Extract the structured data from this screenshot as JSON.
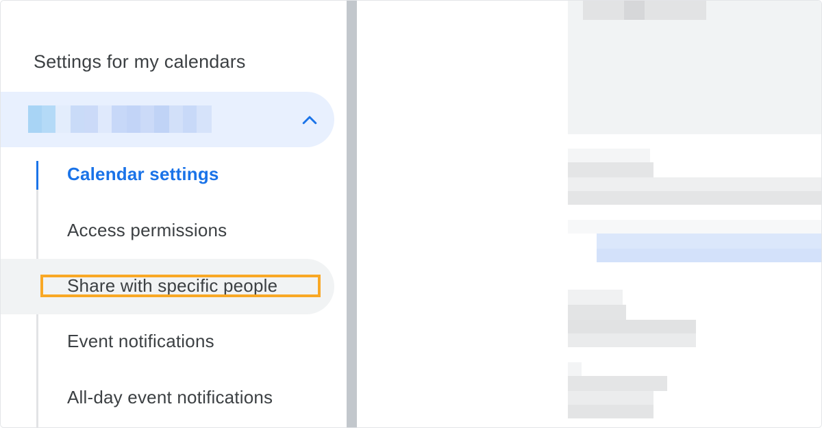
{
  "sidebar": {
    "section_title": "Settings for my calendars",
    "calendar_name_redacted": true,
    "expand_icon": "chevron-up-icon",
    "items": [
      {
        "label": "Calendar settings",
        "active": true
      },
      {
        "label": "Access permissions",
        "active": false
      },
      {
        "label": "Share with specific people",
        "active": false,
        "hovered": true,
        "highlighted": true
      },
      {
        "label": "Event notifications",
        "active": false
      },
      {
        "label": "All-day event notifications",
        "active": false
      }
    ]
  },
  "colors": {
    "accent": "#1a73e8",
    "selected_row_bg": "#e8f0fe",
    "hover_row_bg": "#f1f3f4",
    "highlight_outline": "#f9a825",
    "text": "#3c4043"
  },
  "content": {
    "redacted": true
  }
}
